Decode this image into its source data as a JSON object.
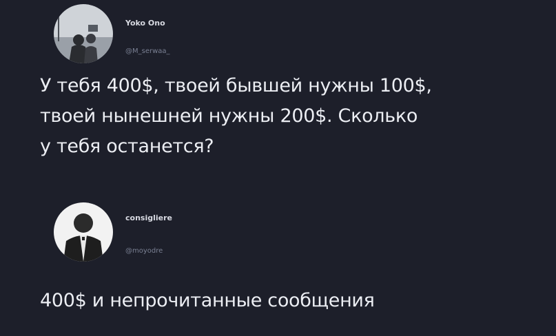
{
  "tweets": [
    {
      "display_name": "Yoko Ono",
      "handle": "@M_serwaa_",
      "avatar_icon": "user-avatar-photo",
      "text": "У тебя 400$, твоей бывшей нужны 100$,\nтвоей нынешней нужны 200$. Сколько\nу тебя останется?"
    },
    {
      "display_name": "consigliere",
      "handle": "@moyodre",
      "avatar_icon": "user-avatar-photo",
      "text": "400$ и непрочитанные сообщения"
    }
  ],
  "colors": {
    "background": "#1d1f2a",
    "text": "#eceef3",
    "handle": "#7a8093"
  }
}
